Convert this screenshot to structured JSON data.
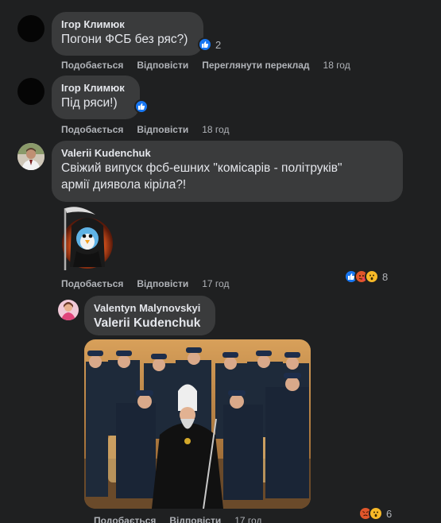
{
  "comments": [
    {
      "author": "Ігор Климюк",
      "text": "Погони ФСБ без ряс?)",
      "reaction_count": "2",
      "actions": {
        "like": "Подобається",
        "reply": "Відповісти",
        "translate": "Переглянути переклад",
        "time": "18 год"
      }
    },
    {
      "author": "Ігор Климюк",
      "text": "Під ряси!)",
      "actions": {
        "like": "Подобається",
        "reply": "Відповісти",
        "time": "18 год"
      }
    },
    {
      "author": "Valerii Kudenchuk",
      "text_line1": "Свіжий випуск фсб-ешних \"комісарів - політруків\"",
      "text_line2": "армії диявола кіріла?!",
      "reaction_count": "8",
      "actions": {
        "like": "Подобається",
        "reply": "Відповісти",
        "time": "17 год"
      }
    },
    {
      "author": "Valentyn Malynovskyi",
      "mention": "Valerii Kudenchuk",
      "reaction_count": "6",
      "actions": {
        "like": "Подобається",
        "reply": "Відповісти",
        "time": "17 год"
      }
    }
  ],
  "colors": {
    "background": "#1f2021",
    "bubble": "#3a3b3c",
    "text": "#e4e6eb",
    "secondary_text": "#b0b3b8",
    "like_blue": "#1877f2"
  }
}
